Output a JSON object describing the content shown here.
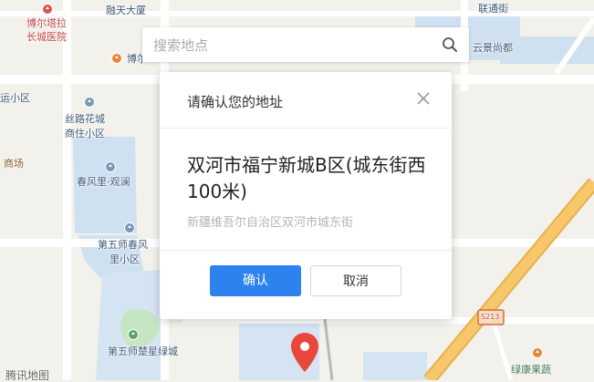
{
  "search": {
    "placeholder": "搜索地点"
  },
  "dialog": {
    "title": "请确认您的地址",
    "address_main": "双河市福宁新城B区(城东街西100米)",
    "address_sub": "新疆维吾尔自治区双河市城东街",
    "confirm_label": "确认",
    "cancel_label": "取消"
  },
  "map": {
    "labels": {
      "boertala_1": "博尔塔拉",
      "boertala_2": "长城医院",
      "rongtian": "融天大厦",
      "liantong": "联通街",
      "yunjing": "云景尚都",
      "bo_partial": "博尔",
      "yunxiaoqu": "运小区",
      "silu_1": "丝路花城",
      "silu_2": "商住小区",
      "shangchang": "商场",
      "chunfeng": "春风里·观澜",
      "wushi_1": "第五师春风",
      "wushi_2": "里小区",
      "chuxing": "第五师楚星绿城",
      "road_badge": "S213",
      "lvkang": "绿康果蔬",
      "tencent": "腾讯地图"
    }
  },
  "colors": {
    "accent": "#2d82ef",
    "marker": "#e8473a",
    "water": "#cfe0f1",
    "green": "#c6e5c2",
    "arterial": "#f7c76a"
  }
}
